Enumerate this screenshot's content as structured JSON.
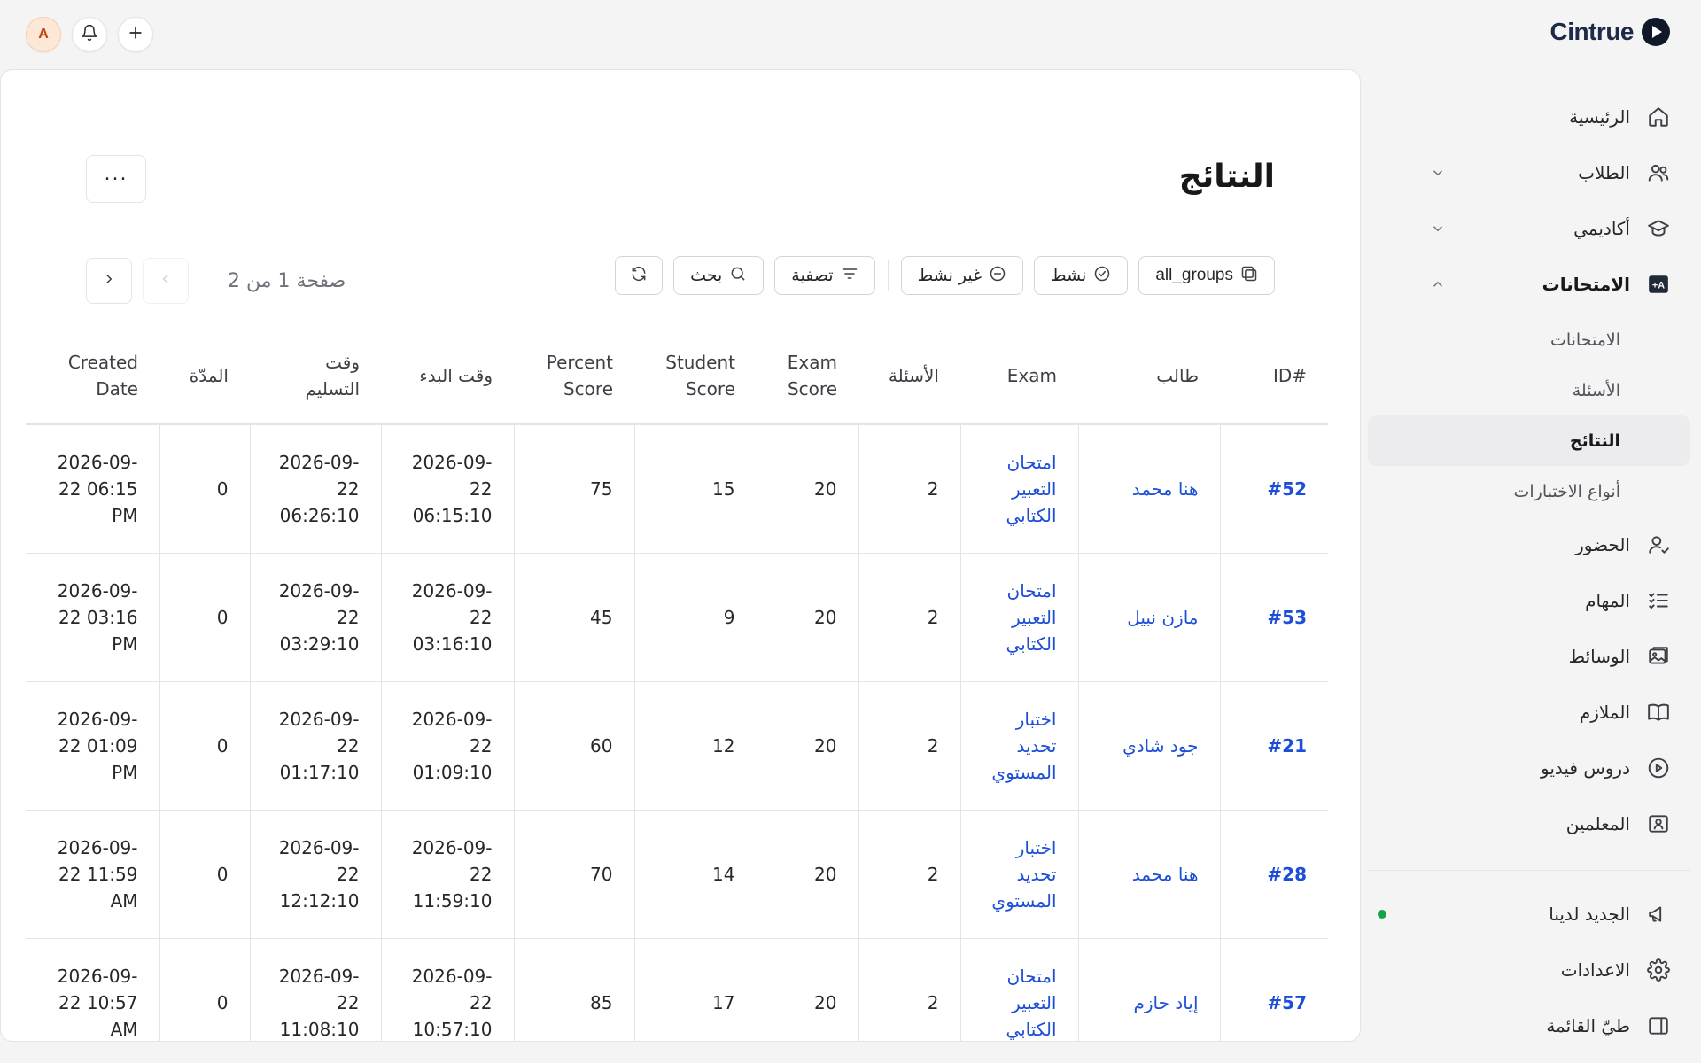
{
  "app": {
    "brand": "Cintrue",
    "avatar_initial": "A"
  },
  "sidebar": {
    "items": [
      {
        "label": "الرئيسية",
        "icon": "home-icon"
      },
      {
        "label": "الطلاب",
        "icon": "users-icon"
      },
      {
        "label": "أكاديمي",
        "icon": "graduation-cap-icon"
      },
      {
        "label": "الامتحانات",
        "icon": "exam-a-plus-icon"
      }
    ],
    "exam_sub": [
      {
        "label": "الامتحانات"
      },
      {
        "label": "الأسئلة"
      },
      {
        "label": "النتائج"
      },
      {
        "label": "أنواع الاختبارات"
      }
    ],
    "more_items": [
      {
        "label": "الحضور",
        "icon": "user-check-icon"
      },
      {
        "label": "المهام",
        "icon": "checklist-icon"
      },
      {
        "label": "الوسائط",
        "icon": "media-icon"
      },
      {
        "label": "الملازم",
        "icon": "book-icon"
      },
      {
        "label": "دروس فيديو",
        "icon": "play-circle-icon"
      },
      {
        "label": "المعلمين",
        "icon": "teacher-board-icon"
      }
    ],
    "bottom": [
      {
        "label": "الجديد لدينا",
        "icon": "megaphone-icon"
      },
      {
        "label": "الاعدادات",
        "icon": "gear-icon"
      },
      {
        "label": "طيّ القائمة",
        "icon": "panel-collapse-icon"
      }
    ]
  },
  "page": {
    "title": "النتائج",
    "more": "..."
  },
  "toolbar": {
    "all_groups": "all_groups",
    "active": "نشط",
    "inactive": "غير نشط",
    "filter": "تصفية",
    "search": "بحث"
  },
  "pager": {
    "text": "صفحة 1 من 2"
  },
  "table": {
    "columns": [
      "ID#",
      "طالب",
      "Exam",
      "الأسئلة",
      "Exam Score",
      "Student Score",
      "Percent Score",
      "وقت البدء",
      "وقت التسليم",
      "المدّة",
      "Created Date"
    ],
    "rows": [
      {
        "id": "#52",
        "student": "هنا محمد",
        "exam": "امتحان التعبير الكتابي",
        "questions": "2",
        "exam_score": "20",
        "student_score": "15",
        "percent": "75",
        "start": "2026-09-22 06:15:10",
        "submit": "2026-09-22 06:26:10",
        "duration": "0",
        "created": "2026-09-22 06:15 PM"
      },
      {
        "id": "#53",
        "student": "مازن نبيل",
        "exam": "امتحان التعبير الكتابي",
        "questions": "2",
        "exam_score": "20",
        "student_score": "9",
        "percent": "45",
        "start": "2026-09-22 03:16:10",
        "submit": "2026-09-22 03:29:10",
        "duration": "0",
        "created": "2026-09-22 03:16 PM"
      },
      {
        "id": "#21",
        "student": "جود شادي",
        "exam": "اختبار تحديد المستوي",
        "questions": "2",
        "exam_score": "20",
        "student_score": "12",
        "percent": "60",
        "start": "2026-09-22 01:09:10",
        "submit": "2026-09-22 01:17:10",
        "duration": "0",
        "created": "2026-09-22 01:09 PM"
      },
      {
        "id": "#28",
        "student": "هنا محمد",
        "exam": "اختبار تحديد المستوي",
        "questions": "2",
        "exam_score": "20",
        "student_score": "14",
        "percent": "70",
        "start": "2026-09-22 11:59:10",
        "submit": "2026-09-22 12:12:10",
        "duration": "0",
        "created": "2026-09-22 11:59 AM"
      },
      {
        "id": "#57",
        "student": "إياد حازم",
        "exam": "امتحان التعبير الكتابي",
        "questions": "2",
        "exam_score": "20",
        "student_score": "17",
        "percent": "85",
        "start": "2026-09-22 10:57:10",
        "submit": "2026-09-22 11:08:10",
        "duration": "0",
        "created": "2026-09-22 10:57 AM"
      }
    ]
  },
  "colors": {
    "link": "#1d4ed8",
    "status_dot": "#16a34a",
    "brand": "#1e2a4a"
  }
}
